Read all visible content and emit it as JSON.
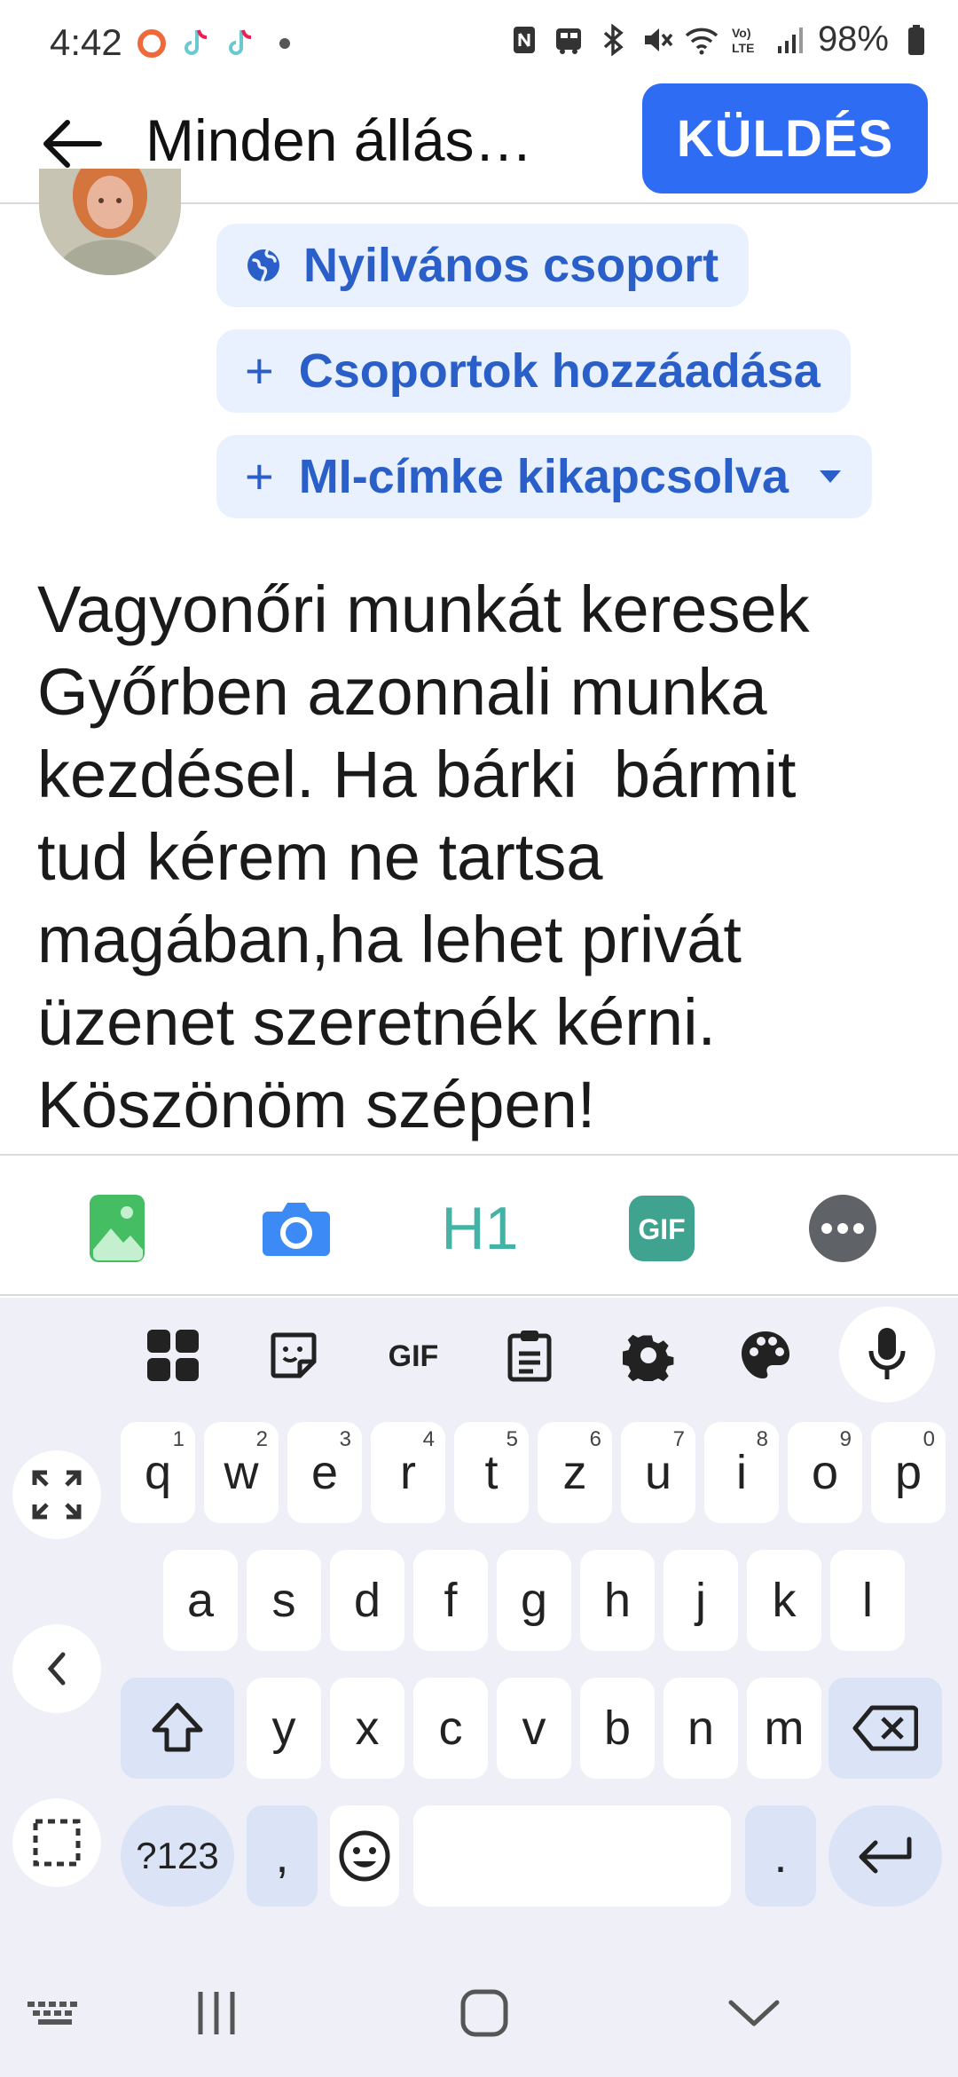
{
  "status_bar": {
    "time": "4:42",
    "battery": "98%",
    "left_icons": [
      "record-icon",
      "tiktok-icon",
      "tiktok-icon",
      "dot-icon"
    ],
    "right_icons": [
      "nfc-icon",
      "car-icon",
      "bluetooth-icon",
      "mute-icon",
      "wifi-icon",
      "volte-icon",
      "signal-icon",
      "battery-icon"
    ]
  },
  "header": {
    "title": "Minden állás…",
    "send_label": "KÜLDÉS",
    "accent": "#2d6cf3"
  },
  "audience": {
    "visibility_label": "Nyilvános csoport",
    "add_groups_label": "Csoportok hozzáadása",
    "ai_label_toggle": "MI-címke kikapcsolva",
    "chip_bg": "#e8f1fd",
    "chip_text": "#2a5ec8"
  },
  "post": {
    "text": "Vagyonőri munkát keresek\nGyőrben azonnali munka\nkezdésel. Ha bárki  bármit\ntud kérem ne tartsa\nmagában,ha lehet privát\nüzenet szeretnék kérni.\nKöszönöm szépen!"
  },
  "composer_toolbar": {
    "items": [
      "photo-icon",
      "camera-icon",
      "heading-icon",
      "gif-icon",
      "more-icon"
    ],
    "heading_label": "H1",
    "gif_label": "GIF"
  },
  "keyboard": {
    "toolbar": [
      "apps-icon",
      "sticker-icon",
      "gif-icon",
      "clipboard-icon",
      "settings-icon",
      "palette-icon",
      "mic-icon"
    ],
    "toolbar_gif_label": "GIF",
    "row1": [
      {
        "key": "q",
        "hint": "1"
      },
      {
        "key": "w",
        "hint": "2"
      },
      {
        "key": "e",
        "hint": "3"
      },
      {
        "key": "r",
        "hint": "4"
      },
      {
        "key": "t",
        "hint": "5"
      },
      {
        "key": "z",
        "hint": "6"
      },
      {
        "key": "u",
        "hint": "7"
      },
      {
        "key": "i",
        "hint": "8"
      },
      {
        "key": "o",
        "hint": "9"
      },
      {
        "key": "p",
        "hint": "0"
      }
    ],
    "row2": [
      "a",
      "s",
      "d",
      "f",
      "g",
      "h",
      "j",
      "k",
      "l"
    ],
    "row3": [
      "y",
      "x",
      "c",
      "v",
      "b",
      "n",
      "m"
    ],
    "symbols_label": "?123",
    "comma_label": ",",
    "period_label": "."
  },
  "nav_bar": {
    "items": [
      "keyboard-hide-icon",
      "recents-icon",
      "home-icon",
      "back-down-icon"
    ]
  }
}
